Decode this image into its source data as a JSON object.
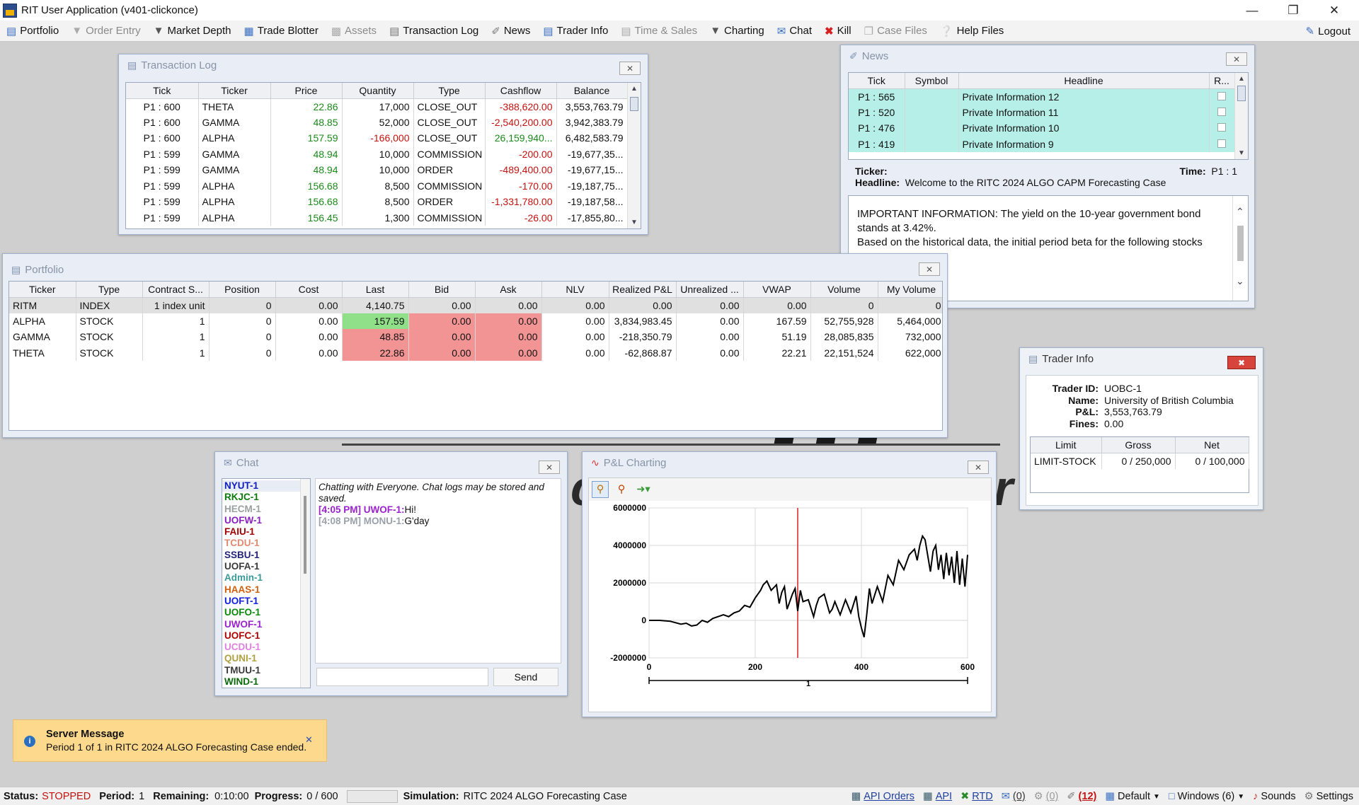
{
  "app": {
    "title": "RIT User Application (v401-clickonce)"
  },
  "toolbar": {
    "items": [
      {
        "label": "Portfolio",
        "icon": "portfolio-icon",
        "enabled": true
      },
      {
        "label": "Order Entry",
        "icon": "dropdown-icon",
        "enabled": false
      },
      {
        "label": "Market Depth",
        "icon": "dropdown-icon",
        "enabled": true
      },
      {
        "label": "Trade Blotter",
        "icon": "blotter-icon",
        "enabled": true
      },
      {
        "label": "Assets",
        "icon": "assets-icon",
        "enabled": false
      },
      {
        "label": "Transaction Log",
        "icon": "log-icon",
        "enabled": true
      },
      {
        "label": "News",
        "icon": "tag-icon",
        "enabled": true
      },
      {
        "label": "Trader Info",
        "icon": "id-card-icon",
        "enabled": true
      },
      {
        "label": "Time & Sales",
        "icon": "clock-table-icon",
        "enabled": false
      },
      {
        "label": "Charting",
        "icon": "dropdown-icon",
        "enabled": true
      },
      {
        "label": "Chat",
        "icon": "chat-icon",
        "enabled": true
      },
      {
        "label": "Kill",
        "icon": "x-icon",
        "enabled": true
      },
      {
        "label": "Case Files",
        "icon": "files-icon",
        "enabled": false
      },
      {
        "label": "Help Files",
        "icon": "help-icon",
        "enabled": true
      }
    ],
    "logout": "Logout"
  },
  "transaction_log": {
    "title": "Transaction Log",
    "columns": [
      "Tick",
      "Ticker",
      "Price",
      "Quantity",
      "Type",
      "Cashflow",
      "Balance"
    ],
    "rows": [
      [
        "P1 : 600",
        "THETA",
        "22.86",
        "17,000",
        "CLOSE_OUT",
        "-388,620.00",
        "3,553,763.79"
      ],
      [
        "P1 : 600",
        "GAMMA",
        "48.85",
        "52,000",
        "CLOSE_OUT",
        "-2,540,200.00",
        "3,942,383.79"
      ],
      [
        "P1 : 600",
        "ALPHA",
        "157.59",
        "-166,000",
        "CLOSE_OUT",
        "26,159,940...",
        "6,482,583.79"
      ],
      [
        "P1 : 599",
        "GAMMA",
        "48.94",
        "10,000",
        "COMMISSION",
        "-200.00",
        "-19,677,35..."
      ],
      [
        "P1 : 599",
        "GAMMA",
        "48.94",
        "10,000",
        "ORDER",
        "-489,400.00",
        "-19,677,15..."
      ],
      [
        "P1 : 599",
        "ALPHA",
        "156.68",
        "8,500",
        "COMMISSION",
        "-170.00",
        "-19,187,75..."
      ],
      [
        "P1 : 599",
        "ALPHA",
        "156.68",
        "8,500",
        "ORDER",
        "-1,331,780.00",
        "-19,187,58..."
      ],
      [
        "P1 : 599",
        "ALPHA",
        "156.45",
        "1,300",
        "COMMISSION",
        "-26.00",
        "-17,855,80..."
      ]
    ]
  },
  "news": {
    "title": "News",
    "columns": [
      "Tick",
      "Symbol",
      "Headline",
      "R..."
    ],
    "rows": [
      [
        "P1 : 565",
        "",
        "Private Information 12"
      ],
      [
        "P1 : 520",
        "",
        "Private Information 11"
      ],
      [
        "P1 : 476",
        "",
        "Private Information 10"
      ],
      [
        "P1 : 419",
        "",
        "Private Information 9"
      ]
    ],
    "detail": {
      "ticker_label": "Ticker:",
      "ticker": "",
      "time_label": "Time:",
      "time": "P1 : 1",
      "headline_label": "Headline:",
      "headline": "Welcome to the RITC 2024 ALGO CAPM Forecasting Case",
      "body_lines": [
        "IMPORTANT INFORMATION: The yield on the 10-year government bond",
        "stands at 3.42%.",
        "Based on the historical data, the initial period beta for the following stocks"
      ]
    }
  },
  "portfolio": {
    "title": "Portfolio",
    "columns": [
      "Ticker",
      "Type",
      "Contract S...",
      "Position",
      "Cost",
      "Last",
      "Bid",
      "Ask",
      "NLV",
      "Realized P&L",
      "Unrealized ...",
      "VWAP",
      "Volume",
      "My Volume"
    ],
    "rows": [
      [
        "RITM",
        "INDEX",
        "1 index unit",
        "0",
        "0.00",
        "4,140.75",
        "0.00",
        "0.00",
        "0.00",
        "0.00",
        "0.00",
        "0.00",
        "0",
        "0"
      ],
      [
        "ALPHA",
        "STOCK",
        "1",
        "0",
        "0.00",
        "157.59",
        "0.00",
        "0.00",
        "0.00",
        "3,834,983.45",
        "0.00",
        "167.59",
        "52,755,928",
        "5,464,000"
      ],
      [
        "GAMMA",
        "STOCK",
        "1",
        "0",
        "0.00",
        "48.85",
        "0.00",
        "0.00",
        "0.00",
        "-218,350.79",
        "0.00",
        "51.19",
        "28,085,835",
        "732,000"
      ],
      [
        "THETA",
        "STOCK",
        "1",
        "0",
        "0.00",
        "22.86",
        "0.00",
        "0.00",
        "0.00",
        "-62,868.87",
        "0.00",
        "22.21",
        "22,151,524",
        "622,000"
      ]
    ]
  },
  "trader_info": {
    "title": "Trader Info",
    "fields": [
      {
        "label": "Trader ID:",
        "value": "UOBC-1"
      },
      {
        "label": "Name:",
        "value": "University of British Columbia"
      },
      {
        "label": "P&L:",
        "value": "3,553,763.79"
      },
      {
        "label": "Fines:",
        "value": "0.00"
      }
    ],
    "limits": {
      "columns": [
        "Limit",
        "Gross",
        "Net"
      ],
      "rows": [
        [
          "LIMIT-STOCK",
          "0 / 250,000",
          "0 / 100,000"
        ]
      ]
    }
  },
  "chat": {
    "title": "Chat",
    "users": [
      {
        "name": "NYUT-1",
        "color": "#1020c0"
      },
      {
        "name": "RKJC-1",
        "color": "#0a7a0a"
      },
      {
        "name": "HECM-1",
        "color": "#9aa0a0"
      },
      {
        "name": "UOFW-1",
        "color": "#8a1fc0"
      },
      {
        "name": "FAIU-1",
        "color": "#a00000"
      },
      {
        "name": "TCDU-1",
        "color": "#e08a70"
      },
      {
        "name": "SSBU-1",
        "color": "#23237a"
      },
      {
        "name": "UOFA-1",
        "color": "#3a3a3a"
      },
      {
        "name": "Admin-1",
        "color": "#3a9a9a"
      },
      {
        "name": "HAAS-1",
        "color": "#d06010"
      },
      {
        "name": "UOFT-1",
        "color": "#1020e0"
      },
      {
        "name": "UOFO-1",
        "color": "#0a8a0a"
      },
      {
        "name": "UWOF-1",
        "color": "#9a20d0"
      },
      {
        "name": "UOFC-1",
        "color": "#b00000"
      },
      {
        "name": "UCDU-1",
        "color": "#e080e0"
      },
      {
        "name": "QUNI-1",
        "color": "#b0a040"
      },
      {
        "name": "TMUU-1",
        "color": "#3a3a3a"
      },
      {
        "name": "WIND-1",
        "color": "#0a6a0a"
      }
    ],
    "intro": "Chatting with Everyone. Chat logs may be stored and saved.",
    "messages": [
      {
        "time": "[4:05 PM]",
        "user": "UWOF-1:",
        "text": "Hi!",
        "color": "#9a20d0"
      },
      {
        "time": "[4:08 PM]",
        "user": "MONU-1:",
        "text": "G'day",
        "color": "#9aa0a8"
      }
    ],
    "send": "Send"
  },
  "pnl_chart": {
    "title": "P&L Charting"
  },
  "chart_data": {
    "type": "line",
    "title": "",
    "xlabel": "1",
    "ylabel": "",
    "xlim": [
      0,
      600
    ],
    "ylim": [
      -2000000,
      6000000
    ],
    "xticks": [
      "0",
      "200",
      "400",
      "600"
    ],
    "yticks": [
      "6000000",
      "4000000",
      "2000000",
      "0",
      "-2000000"
    ],
    "marker_x": 280,
    "grid": true,
    "series": [
      {
        "x": [
          0,
          20,
          40,
          60,
          70,
          80,
          90,
          100,
          110,
          120,
          130,
          140,
          150,
          160,
          170,
          180,
          190,
          200,
          210,
          215,
          222,
          230,
          240,
          245,
          250,
          255,
          260,
          265,
          270,
          275,
          280,
          285,
          290,
          300,
          310,
          315,
          320,
          330,
          340,
          345,
          350,
          360,
          370,
          380,
          390,
          395,
          400,
          405,
          410,
          415,
          420,
          430,
          440,
          450,
          460,
          470,
          480,
          490,
          500,
          505,
          510,
          515,
          520,
          530,
          535,
          540,
          545,
          550,
          555,
          560,
          565,
          570,
          575,
          580,
          585,
          590,
          595,
          600
        ],
        "y": [
          0,
          0,
          -50000,
          -200000,
          -150000,
          -300000,
          -250000,
          0,
          -100000,
          100000,
          200000,
          300000,
          200000,
          400000,
          500000,
          800000,
          700000,
          1200000,
          1600000,
          1900000,
          2100000,
          1600000,
          1900000,
          900000,
          1500000,
          1800000,
          600000,
          1000000,
          1400000,
          1700000,
          500000,
          1600000,
          1000000,
          1100000,
          200000,
          800000,
          1200000,
          1400000,
          400000,
          600000,
          1000000,
          300000,
          1100000,
          400000,
          1300000,
          200000,
          -400000,
          -900000,
          300000,
          1700000,
          900000,
          1800000,
          1000000,
          2400000,
          1900000,
          3200000,
          2700000,
          3500000,
          3800000,
          3200000,
          4000000,
          4500000,
          4300000,
          2600000,
          3700000,
          4000000,
          2700000,
          3500000,
          2200000,
          3600000,
          2400000,
          3400000,
          2000000,
          3700000,
          1900000,
          3300000,
          1800000,
          3500000
        ]
      }
    ]
  },
  "server_message": {
    "title": "Server Message",
    "text": "Period 1 of 1 in RITC 2024 ALGO Forecasting Case ended."
  },
  "status": {
    "status_label": "Status:",
    "status": "STOPPED",
    "period_label": "Period:",
    "period": "1",
    "remaining_label": "Remaining:",
    "remaining": "0:10:00",
    "progress_label": "Progress:",
    "progress": "0 / 600",
    "progress_value": 0,
    "simulation_label": "Simulation:",
    "simulation": "RITC 2024 ALGO Forecasting Case",
    "right": {
      "api_orders": "API Orders",
      "api": "API",
      "rtd": "RTD",
      "chat_count": "(0)",
      "trade_count": "(0)",
      "news_count": "(12)",
      "layout": "Default",
      "windows": "Windows (6)",
      "sounds": "Sounds",
      "settings": "Settings"
    }
  },
  "colors": {
    "green_cell": "#90e08a",
    "red_cell": "#f29494",
    "news_row": "#b6eee8",
    "stopped": "#c4120f",
    "marker": "#d92020"
  }
}
